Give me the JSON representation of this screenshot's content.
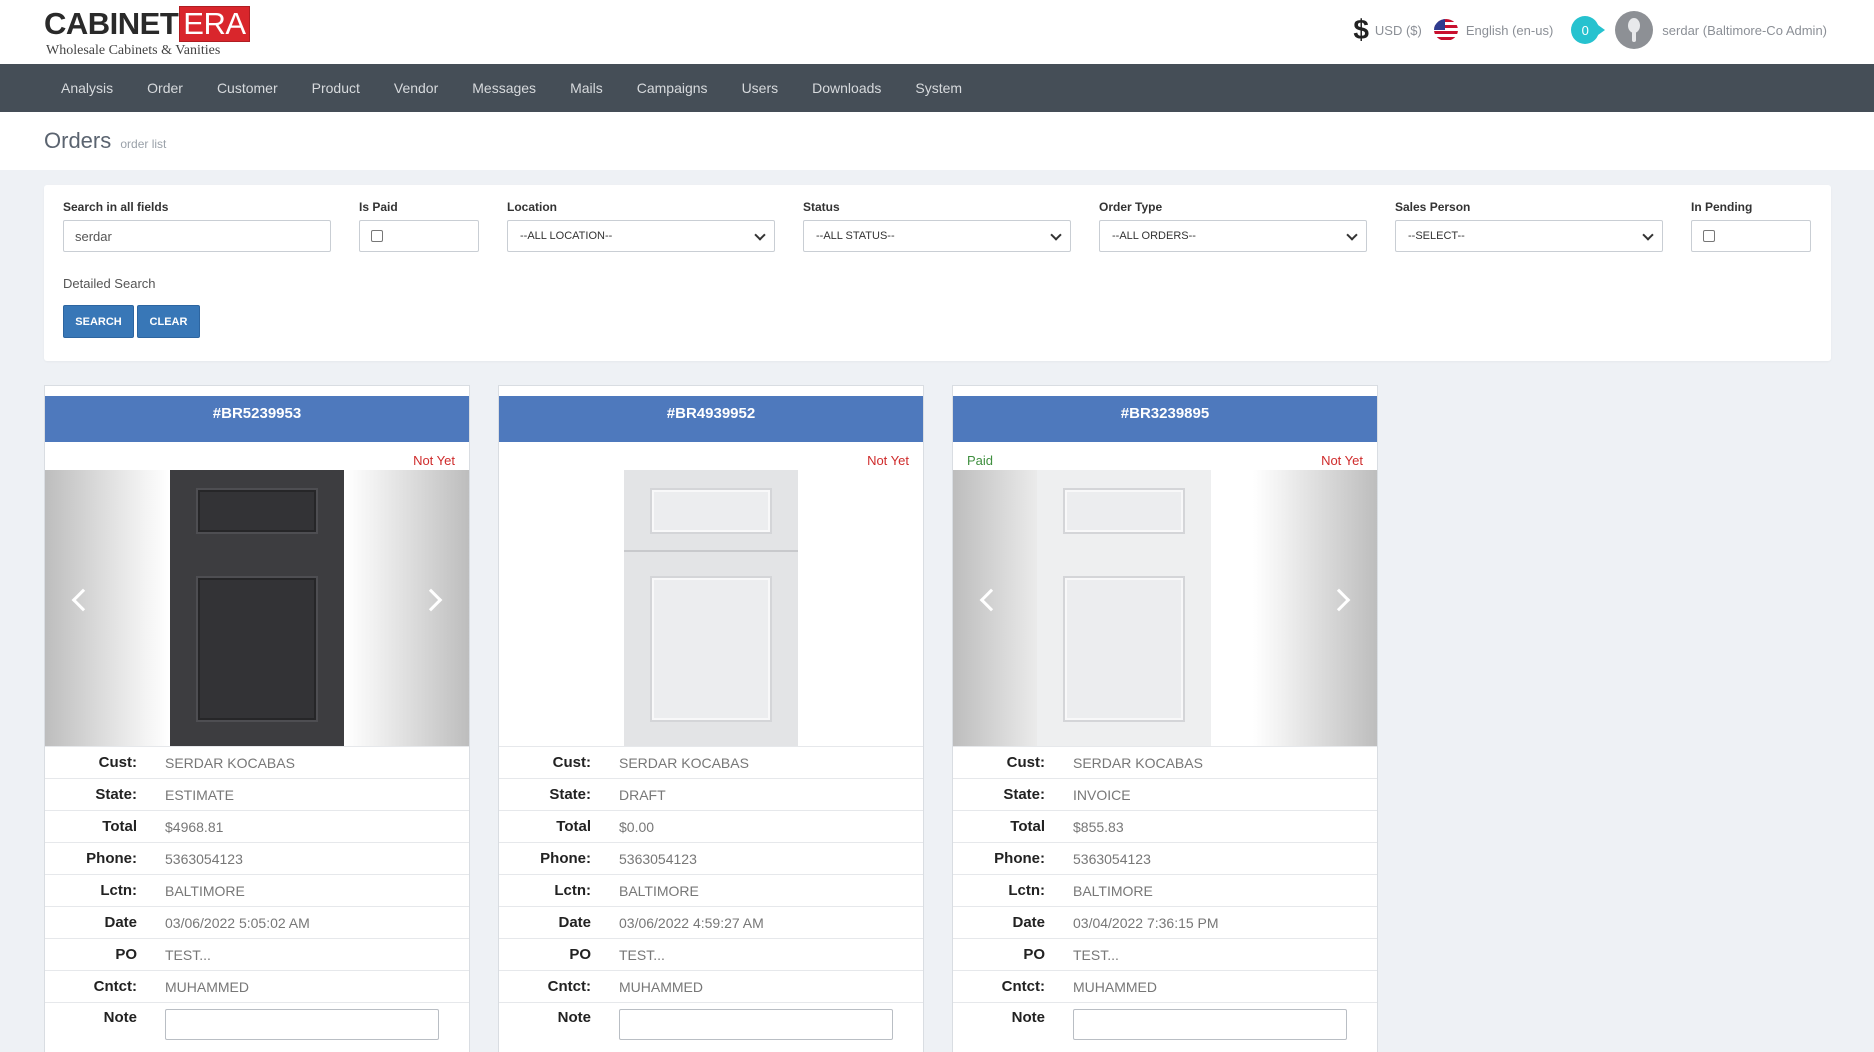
{
  "header": {
    "logo_main": "CABINET",
    "logo_era": "ERA",
    "logo_sub": "Wholesale Cabinets & Vanities",
    "currency": "USD ($)",
    "language": "English (en-us)",
    "notifications": "0",
    "user": "serdar (Baltimore-Co Admin)"
  },
  "nav": [
    "Analysis",
    "Order",
    "Customer",
    "Product",
    "Vendor",
    "Messages",
    "Mails",
    "Campaigns",
    "Users",
    "Downloads",
    "System"
  ],
  "page": {
    "title": "Orders",
    "subtitle": "order list"
  },
  "filters": {
    "search_label": "Search in all fields",
    "search_value": "serdar",
    "is_paid_label": "Is Paid",
    "location_label": "Location",
    "location_value": "--ALL LOCATION--",
    "status_label": "Status",
    "status_value": "--ALL STATUS--",
    "order_type_label": "Order Type",
    "order_type_value": "--ALL ORDERS--",
    "sales_person_label": "Sales Person",
    "sales_person_value": "--SELECT--",
    "in_pending_label": "In Pending",
    "detailed_search": "Detailed Search",
    "search_button": "SEARCH",
    "clear_button": "CLEAR"
  },
  "field_labels": {
    "cust": "Cust:",
    "state": "State:",
    "total": "Total",
    "phone": "Phone:",
    "lctn": "Lctn:",
    "date": "Date",
    "po": "PO",
    "cntct": "Cntct:",
    "note": "Note"
  },
  "orders": [
    {
      "id": "#BR5239953",
      "paid": "",
      "payment_status": "Not Yet",
      "door_finish": "dark",
      "cust": "SERDAR KOCABAS",
      "state": "ESTIMATE",
      "total": "$4968.81",
      "phone": "5363054123",
      "lctn": "BALTIMORE",
      "date": "03/06/2022 5:05:02 AM",
      "po": "TEST...",
      "cntct": "MUHAMMED"
    },
    {
      "id": "#BR4939952",
      "paid": "",
      "payment_status": "Not Yet",
      "door_finish": "light",
      "cust": "SERDAR KOCABAS",
      "state": "DRAFT",
      "total": "$0.00",
      "phone": "5363054123",
      "lctn": "BALTIMORE",
      "date": "03/06/2022 4:59:27 AM",
      "po": "TEST...",
      "cntct": "MUHAMMED"
    },
    {
      "id": "#BR3239895",
      "paid": "Paid",
      "payment_status": "Not Yet",
      "door_finish": "light",
      "cust": "SERDAR KOCABAS",
      "state": "INVOICE",
      "total": "$855.83",
      "phone": "5363054123",
      "lctn": "BALTIMORE",
      "date": "03/04/2022 7:36:15 PM",
      "po": "TEST...",
      "cntct": "MUHAMMED"
    }
  ],
  "colors": {
    "nav_bg": "#454e57",
    "card_header": "#4e79bd",
    "button": "#3877b7",
    "paid": "#3f8f3f",
    "not_yet": "#cf2b2b",
    "badge": "#26c2cf",
    "logo_red": "#d9262c"
  }
}
